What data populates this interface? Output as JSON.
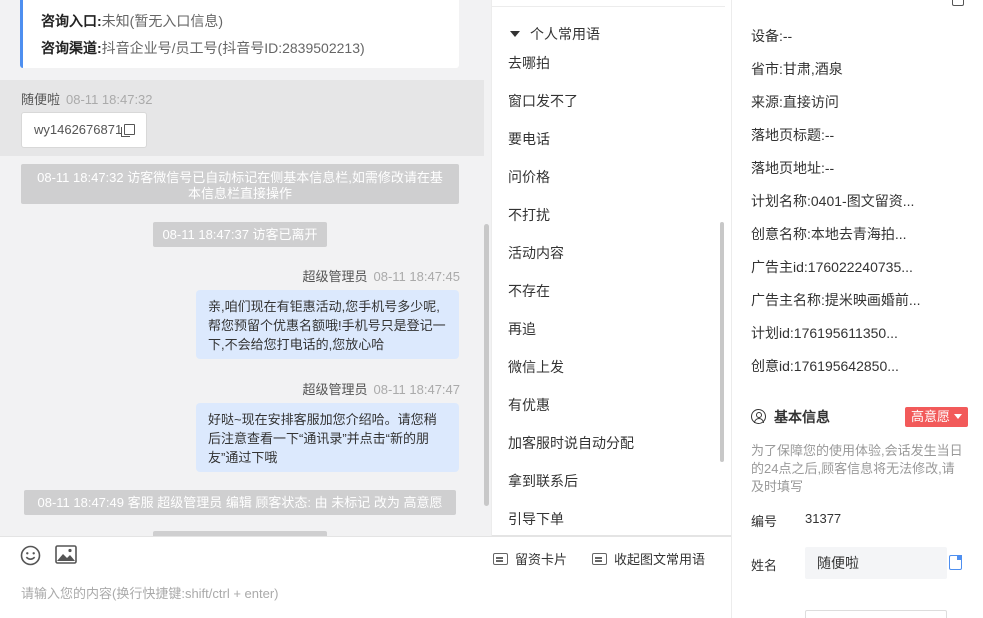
{
  "chat": {
    "info_card": {
      "entry_label": "咨询入口:",
      "entry_value": "未知(暂无入口信息)",
      "channel_label": "咨询渠道:",
      "channel_value": "抖音企业号/员工号(抖音号ID:2839502213)"
    },
    "visitor_msg": {
      "sender": "随便啦",
      "time": "08-11 18:47:32",
      "wechat": "wy1462676871"
    },
    "system_msgs": [
      "08-11 18:47:32 访客微信号已自动标记在侧基本信息栏,如需修改请在基本信息栏直接操作",
      "08-11 18:47:37 访客已离开",
      "08-11 18:47:49 客服 超级管理员 编辑 顾客状态: 由 未标记 改为 高意愿"
    ],
    "agent_msgs": [
      {
        "sender": "超级管理员",
        "time": "08-11 18:47:45",
        "text": "亲,咱们现在有钜惠活动,您手机号多少呢,帮您预留个优惠名额哦!手机号只是登记一下,不会给您打电话的,您放心哈"
      },
      {
        "sender": "超级管理员",
        "time": "08-11 18:47:47",
        "text": "好哒~现在安排客服加您介绍哈。请您稍后注意查看一下“通讯录”并点击“新的朋友”通过下哦"
      }
    ],
    "input": {
      "placeholder": "请输入您的内容(换行快捷键:shift/ctrl + enter)",
      "lead_card_label": "留资卡片",
      "collapse_label": "收起图文常用语",
      "emoji_icon": "emoji-icon",
      "image_icon": "image-icon"
    }
  },
  "phrases": {
    "group_title": "个人常用语",
    "items": [
      "去哪拍",
      "窗口发不了",
      "要电话",
      "问价格",
      "不打扰",
      "活动内容",
      "不存在",
      "再追",
      "微信上发",
      "有优惠",
      "加客服时说自动分配",
      "拿到联系后",
      "引导下单"
    ]
  },
  "visitor_info": {
    "fields": [
      {
        "label": "设备:",
        "value": "--"
      },
      {
        "label": "省市:",
        "value": "甘肃,酒泉"
      },
      {
        "label": "来源:",
        "value": "直接访问"
      },
      {
        "label": "落地页标题:",
        "value": "--"
      },
      {
        "label": "落地页地址:",
        "value": "--"
      },
      {
        "label": "计划名称:",
        "value": "0401-图文留资..."
      },
      {
        "label": "创意名称:",
        "value": "本地去青海拍..."
      },
      {
        "label": "广告主id:",
        "value": "176022240735..."
      },
      {
        "label": "广告主名称:",
        "value": "提米映画婚前..."
      },
      {
        "label": "计划id:",
        "value": "176195611350..."
      },
      {
        "label": "创意id:",
        "value": "176195642850..."
      }
    ]
  },
  "basic_info": {
    "title": "基本信息",
    "intent_badge": "高意愿",
    "notice": "为了保障您的使用体验,会话发生当日的24点之后,顾客信息将无法修改,请及时填写",
    "id_label": "编号",
    "id_value": "31377",
    "name_label": "姓名",
    "name_value": "随便啦"
  },
  "colors": {
    "accent": "#4e8ff0",
    "intent_red": "#f25a5a",
    "outgoing_bubble": "#dce9fd",
    "system_bg": "#cfcfd0"
  }
}
